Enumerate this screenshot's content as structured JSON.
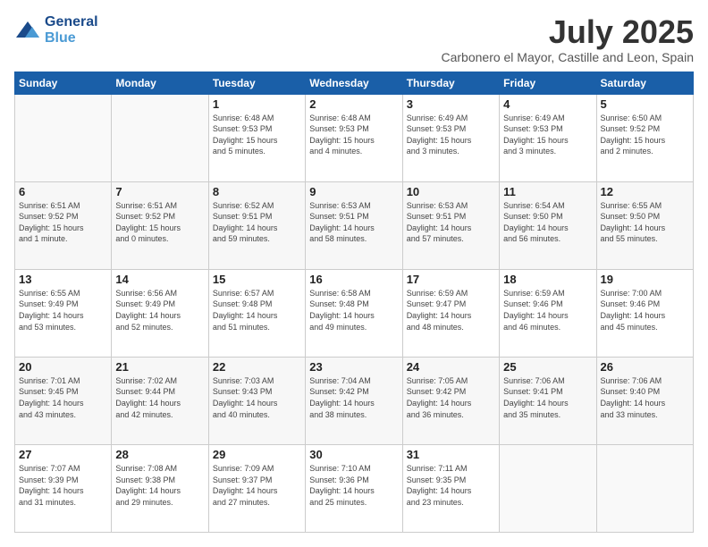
{
  "header": {
    "logo_line1": "General",
    "logo_line2": "Blue",
    "month": "July 2025",
    "location": "Carbonero el Mayor, Castille and Leon, Spain"
  },
  "weekdays": [
    "Sunday",
    "Monday",
    "Tuesday",
    "Wednesday",
    "Thursday",
    "Friday",
    "Saturday"
  ],
  "weeks": [
    [
      {
        "day": "",
        "info": ""
      },
      {
        "day": "",
        "info": ""
      },
      {
        "day": "1",
        "info": "Sunrise: 6:48 AM\nSunset: 9:53 PM\nDaylight: 15 hours\nand 5 minutes."
      },
      {
        "day": "2",
        "info": "Sunrise: 6:48 AM\nSunset: 9:53 PM\nDaylight: 15 hours\nand 4 minutes."
      },
      {
        "day": "3",
        "info": "Sunrise: 6:49 AM\nSunset: 9:53 PM\nDaylight: 15 hours\nand 3 minutes."
      },
      {
        "day": "4",
        "info": "Sunrise: 6:49 AM\nSunset: 9:53 PM\nDaylight: 15 hours\nand 3 minutes."
      },
      {
        "day": "5",
        "info": "Sunrise: 6:50 AM\nSunset: 9:52 PM\nDaylight: 15 hours\nand 2 minutes."
      }
    ],
    [
      {
        "day": "6",
        "info": "Sunrise: 6:51 AM\nSunset: 9:52 PM\nDaylight: 15 hours\nand 1 minute."
      },
      {
        "day": "7",
        "info": "Sunrise: 6:51 AM\nSunset: 9:52 PM\nDaylight: 15 hours\nand 0 minutes."
      },
      {
        "day": "8",
        "info": "Sunrise: 6:52 AM\nSunset: 9:51 PM\nDaylight: 14 hours\nand 59 minutes."
      },
      {
        "day": "9",
        "info": "Sunrise: 6:53 AM\nSunset: 9:51 PM\nDaylight: 14 hours\nand 58 minutes."
      },
      {
        "day": "10",
        "info": "Sunrise: 6:53 AM\nSunset: 9:51 PM\nDaylight: 14 hours\nand 57 minutes."
      },
      {
        "day": "11",
        "info": "Sunrise: 6:54 AM\nSunset: 9:50 PM\nDaylight: 14 hours\nand 56 minutes."
      },
      {
        "day": "12",
        "info": "Sunrise: 6:55 AM\nSunset: 9:50 PM\nDaylight: 14 hours\nand 55 minutes."
      }
    ],
    [
      {
        "day": "13",
        "info": "Sunrise: 6:55 AM\nSunset: 9:49 PM\nDaylight: 14 hours\nand 53 minutes."
      },
      {
        "day": "14",
        "info": "Sunrise: 6:56 AM\nSunset: 9:49 PM\nDaylight: 14 hours\nand 52 minutes."
      },
      {
        "day": "15",
        "info": "Sunrise: 6:57 AM\nSunset: 9:48 PM\nDaylight: 14 hours\nand 51 minutes."
      },
      {
        "day": "16",
        "info": "Sunrise: 6:58 AM\nSunset: 9:48 PM\nDaylight: 14 hours\nand 49 minutes."
      },
      {
        "day": "17",
        "info": "Sunrise: 6:59 AM\nSunset: 9:47 PM\nDaylight: 14 hours\nand 48 minutes."
      },
      {
        "day": "18",
        "info": "Sunrise: 6:59 AM\nSunset: 9:46 PM\nDaylight: 14 hours\nand 46 minutes."
      },
      {
        "day": "19",
        "info": "Sunrise: 7:00 AM\nSunset: 9:46 PM\nDaylight: 14 hours\nand 45 minutes."
      }
    ],
    [
      {
        "day": "20",
        "info": "Sunrise: 7:01 AM\nSunset: 9:45 PM\nDaylight: 14 hours\nand 43 minutes."
      },
      {
        "day": "21",
        "info": "Sunrise: 7:02 AM\nSunset: 9:44 PM\nDaylight: 14 hours\nand 42 minutes."
      },
      {
        "day": "22",
        "info": "Sunrise: 7:03 AM\nSunset: 9:43 PM\nDaylight: 14 hours\nand 40 minutes."
      },
      {
        "day": "23",
        "info": "Sunrise: 7:04 AM\nSunset: 9:42 PM\nDaylight: 14 hours\nand 38 minutes."
      },
      {
        "day": "24",
        "info": "Sunrise: 7:05 AM\nSunset: 9:42 PM\nDaylight: 14 hours\nand 36 minutes."
      },
      {
        "day": "25",
        "info": "Sunrise: 7:06 AM\nSunset: 9:41 PM\nDaylight: 14 hours\nand 35 minutes."
      },
      {
        "day": "26",
        "info": "Sunrise: 7:06 AM\nSunset: 9:40 PM\nDaylight: 14 hours\nand 33 minutes."
      }
    ],
    [
      {
        "day": "27",
        "info": "Sunrise: 7:07 AM\nSunset: 9:39 PM\nDaylight: 14 hours\nand 31 minutes."
      },
      {
        "day": "28",
        "info": "Sunrise: 7:08 AM\nSunset: 9:38 PM\nDaylight: 14 hours\nand 29 minutes."
      },
      {
        "day": "29",
        "info": "Sunrise: 7:09 AM\nSunset: 9:37 PM\nDaylight: 14 hours\nand 27 minutes."
      },
      {
        "day": "30",
        "info": "Sunrise: 7:10 AM\nSunset: 9:36 PM\nDaylight: 14 hours\nand 25 minutes."
      },
      {
        "day": "31",
        "info": "Sunrise: 7:11 AM\nSunset: 9:35 PM\nDaylight: 14 hours\nand 23 minutes."
      },
      {
        "day": "",
        "info": ""
      },
      {
        "day": "",
        "info": ""
      }
    ]
  ]
}
